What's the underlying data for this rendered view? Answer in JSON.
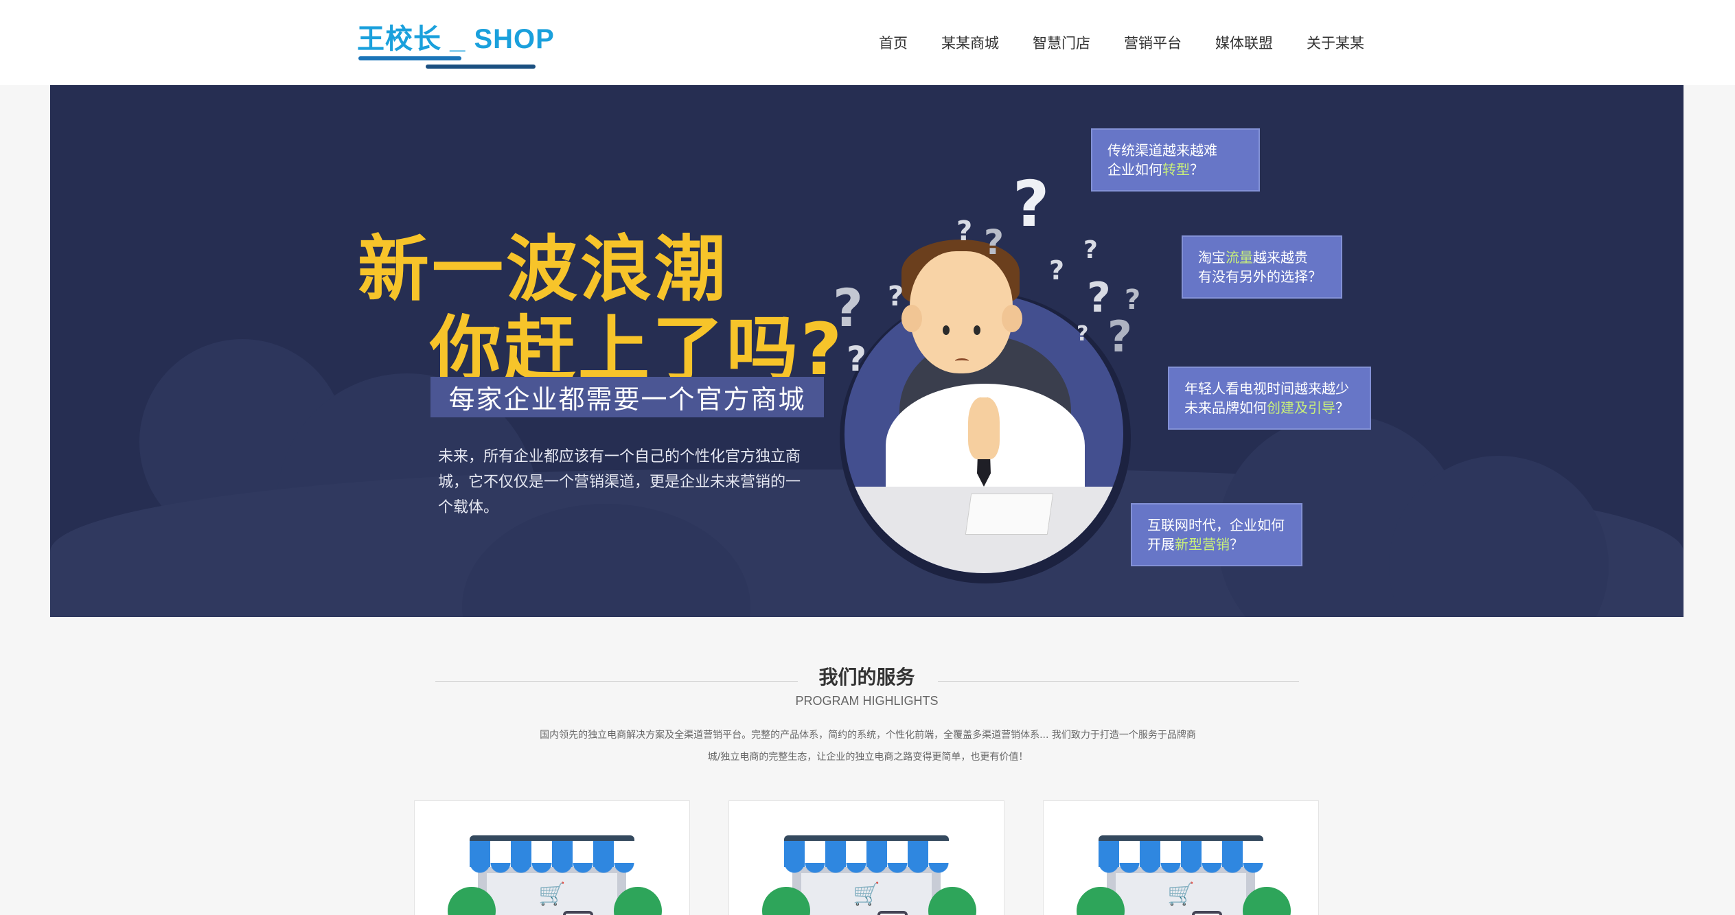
{
  "header": {
    "logo_text": "王校长 _ SHOP",
    "nav": [
      "首页",
      "某某商城",
      "智慧门店",
      "营销平台",
      "媒体联盟",
      "关于某某"
    ]
  },
  "banner": {
    "headline_line1": "新一波浪潮",
    "headline_line2": "你赶上了吗?",
    "subtitle": "每家企业都需要一个官方商城",
    "description": "未来，所有企业都应该有一个自己的个性化官方独立商城，它不仅仅是一个营销渠道，更是企业未来营销的一个载体。",
    "bubbles": [
      {
        "line1": "传统渠道越来越难",
        "line2_pre": "企业如何",
        "line2_hl": "转型",
        "line2_post": "？"
      },
      {
        "line1_pre": "淘宝",
        "line1_hl": "流量",
        "line1_post": "越来越贵",
        "line2": "有没有另外的选择？"
      },
      {
        "line1": "年轻人看电视时间越来越少",
        "line2_pre": "未来品牌如何",
        "line2_hl": "创建及引导",
        "line2_post": "？"
      },
      {
        "line1": "互联网时代，企业如何",
        "line2_pre": "开展",
        "line2_hl": "新型营销",
        "line2_post": "？"
      }
    ],
    "colors": {
      "background": "#262e52",
      "headline": "#f7c42a",
      "bubble": "#6776c7",
      "highlight": "#c9f07a"
    }
  },
  "services": {
    "title": "我们的服务",
    "subtitle": "PROGRAM HIGHLIGHTS",
    "description_line1": "国内领先的独立电商解决方案及全渠道营销平台。完整的产品体系，简约的系统，个性化前端，全覆盖多渠道营销体系... 我们致力于打造一个服务于品牌商",
    "description_line2": "城/独立电商的完整生态，让企业的独立电商之路变得更简单，也更有价值！",
    "cards": [
      {
        "icon": "store-cart-icon"
      },
      {
        "icon": "store-cart-icon"
      },
      {
        "icon": "store-cart-icon"
      }
    ]
  }
}
